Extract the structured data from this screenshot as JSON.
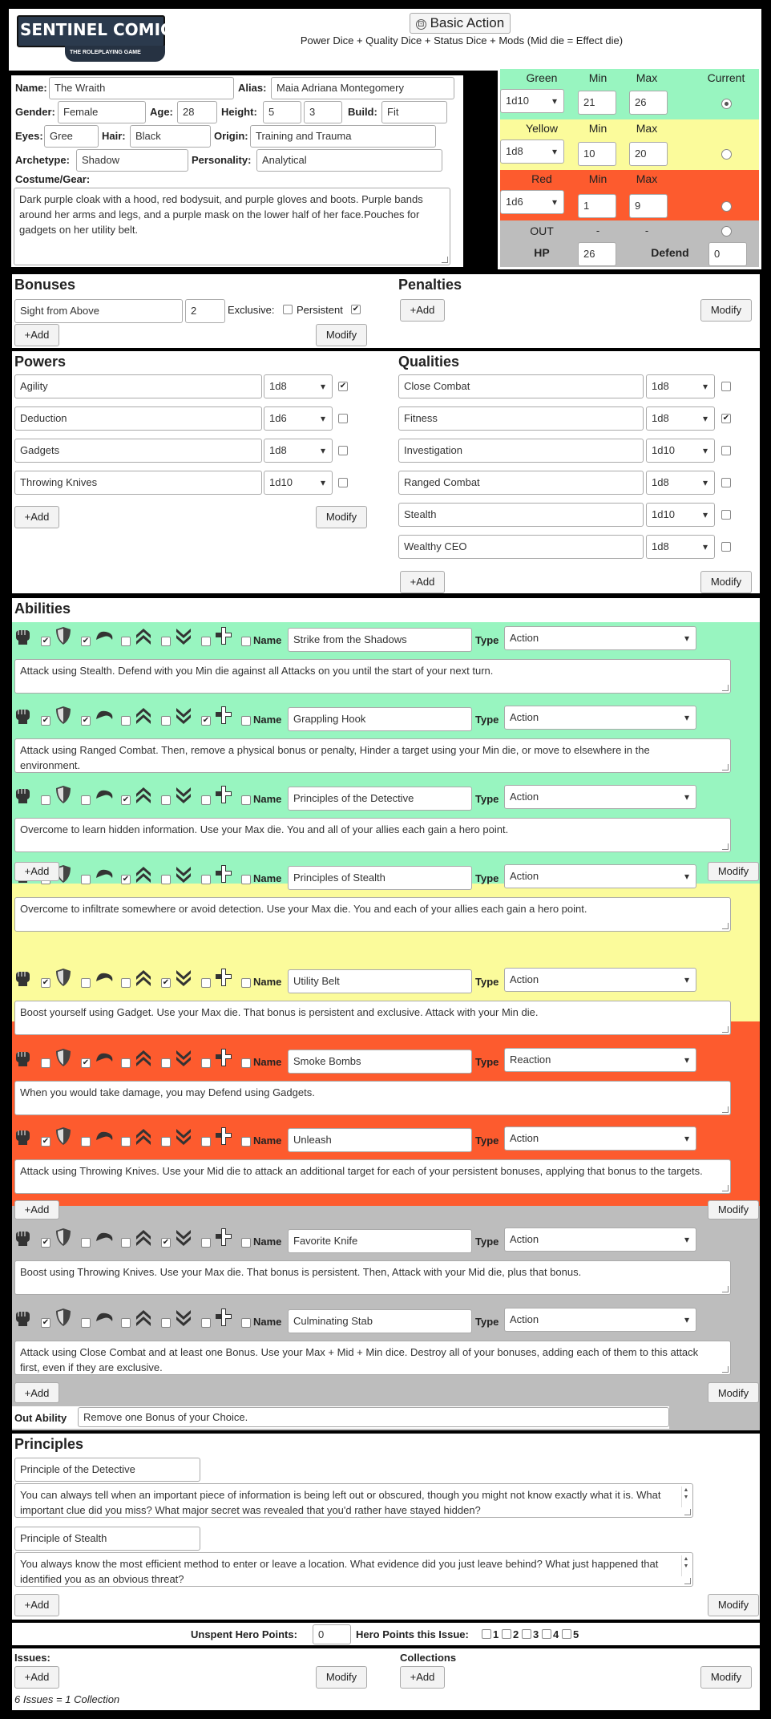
{
  "header": {
    "logo_main": "SENTINEL COMICS",
    "logo_sub": "THE ROLEPLAYING GAME",
    "basic_action": "Basic Action",
    "formula": "Power Dice + Quality Dice + Status Dice + Mods (Mid die = Effect die)"
  },
  "hero": {
    "name_label": "Name:",
    "name": "The Wraith",
    "alias_label": "Alias:",
    "alias": "Maia Adriana Montegomery",
    "gender_label": "Gender:",
    "gender": "Female",
    "age_label": "Age:",
    "age": "28",
    "height_label": "Height:",
    "height_ft": "5",
    "height_in": "3",
    "build_label": "Build:",
    "build": "Fit",
    "eyes_label": "Eyes:",
    "eyes": "Gree",
    "hair_label": "Hair:",
    "hair": "Black",
    "origin_label": "Origin:",
    "origin": "Training and Trauma",
    "archetype_label": "Archetype:",
    "archetype": "Shadow",
    "personality_label": "Personality:",
    "personality": "Analytical",
    "costume_label": "Costume/Gear:",
    "costume": "Dark purple cloak with a hood, red bodysuit, and purple gloves and boots. Purple bands around her arms and legs, and a purple mask on the lower half of her face.Pouches for gadgets on her utility belt."
  },
  "status": {
    "green_label": "Green",
    "yellow_label": "Yellow",
    "red_label": "Red",
    "min_label": "Min",
    "max_label": "Max",
    "current_label": "Current",
    "green_die": "1d10",
    "green_min": "21",
    "green_max": "26",
    "yellow_die": "1d8",
    "yellow_min": "10",
    "yellow_max": "20",
    "red_die": "1d6",
    "red_min": "1",
    "red_max": "9",
    "out_label": "OUT",
    "dash": "-",
    "hp_label": "HP",
    "hp": "26",
    "defend_label": "Defend",
    "defend": "0",
    "colors": {
      "green": "#98f5c0",
      "yellow": "#fbfb9b",
      "red": "#fd5b2e",
      "gray": "#bdbdbd"
    }
  },
  "bonuses": {
    "title": "Bonuses",
    "item_name": "Sight from Above",
    "item_value": "2",
    "exclusive_label": "Exclusive:",
    "persistent_label": "Persistent",
    "add": "+Add",
    "modify": "Modify"
  },
  "penalties": {
    "title": "Penalties",
    "add": "+Add",
    "modify": "Modify"
  },
  "powers": {
    "title": "Powers",
    "items": [
      {
        "name": "Agility",
        "die": "1d8",
        "checked": "✔"
      },
      {
        "name": "Deduction",
        "die": "1d6",
        "checked": ""
      },
      {
        "name": "Gadgets",
        "die": "1d8",
        "checked": ""
      },
      {
        "name": "Throwing Knives",
        "die": "1d10",
        "checked": ""
      }
    ],
    "add": "+Add",
    "modify": "Modify"
  },
  "qualities": {
    "title": "Qualities",
    "items": [
      {
        "name": "Close Combat",
        "die": "1d8",
        "checked": ""
      },
      {
        "name": "Fitness",
        "die": "1d8",
        "checked": "✔"
      },
      {
        "name": "Investigation",
        "die": "1d10",
        "checked": ""
      },
      {
        "name": "Ranged Combat",
        "die": "1d8",
        "checked": ""
      },
      {
        "name": "Stealth",
        "die": "1d10",
        "checked": ""
      },
      {
        "name": "Wealthy CEO",
        "die": "1d8",
        "checked": ""
      }
    ],
    "add": "+Add",
    "modify": "Modify"
  },
  "abilities": {
    "title": "Abilities",
    "name_label": "Name",
    "type_label": "Type",
    "add": "+Add",
    "modify": "Modify",
    "icons": [
      "fist-icon",
      "shield-icon",
      "swirl-icon",
      "chevrons-up-icon",
      "chevrons-down-icon",
      "plus-cross-icon"
    ],
    "items": [
      {
        "name": "Strike from the Shadows",
        "type": "Action",
        "checks": [
          "✔",
          "✔",
          "",
          "",
          "",
          ""
        ],
        "desc": "Attack using Stealth. Defend with you Min die against all Attacks on you until the start of your next turn."
      },
      {
        "name": "Grappling Hook",
        "type": "Action",
        "checks": [
          "✔",
          "✔",
          "",
          "",
          "✔",
          ""
        ],
        "desc": "Attack using Ranged Combat. Then, remove a physical bonus or penalty, Hinder a target using your Min die, or move to elsewhere in the environment."
      },
      {
        "name": "Principles of the Detective",
        "type": "Action",
        "checks": [
          "",
          "",
          "✔",
          "",
          "",
          ""
        ],
        "desc": "Overcome to learn hidden information. Use your Max die. You and all of your allies each gain a hero point."
      },
      {
        "name": "Principles of Stealth",
        "type": "Action",
        "checks": [
          "",
          "",
          "✔",
          "",
          "",
          ""
        ],
        "desc": "Overcome to infiltrate somewhere or avoid detection. Use your Max die. You and each of your allies each gain a hero point."
      },
      {
        "name": "Utility Belt",
        "type": "Action",
        "checks": [
          "✔",
          "",
          "",
          "✔",
          "",
          ""
        ],
        "desc": "Boost yourself using Gadget. Use your Max die. That bonus is persistent and exclusive. Attack with your Min die."
      },
      {
        "name": "Smoke Bombs",
        "type": "Reaction",
        "checks": [
          "",
          "✔",
          "",
          "",
          "",
          ""
        ],
        "desc": "When you would take damage, you may Defend using Gadgets."
      },
      {
        "name": "Unleash",
        "type": "Action",
        "checks": [
          "✔",
          "",
          "",
          "",
          "",
          ""
        ],
        "desc": "Attack using Throwing Knives. Use your Mid die to attack an additional target for each of your persistent bonuses, applying that bonus to the targets."
      },
      {
        "name": "Favorite Knife",
        "type": "Action",
        "checks": [
          "✔",
          "",
          "",
          "✔",
          "",
          ""
        ],
        "desc": "Boost using Throwing Knives. Use your Max die. That bonus is persistent. Then, Attack with your Mid die, plus that bonus."
      },
      {
        "name": "Culminating Stab",
        "type": "Action",
        "checks": [
          "✔",
          "",
          "",
          "",
          "",
          ""
        ],
        "desc": "Attack using Close Combat and at least one Bonus. Use your Max + Mid + Min dice. Destroy all of your bonuses, adding each of them to this attack first, even if they are exclusive."
      }
    ],
    "out_label": "Out Ability",
    "out_value": "Remove one Bonus of your Choice."
  },
  "principles": {
    "title": "Principles",
    "items": [
      {
        "name": "Principle of the Detective",
        "desc": "You can always tell when an important piece of information is being left out or obscured, though you might not know exactly what it is. What important clue did you miss? What major secret was revealed that you'd rather have stayed hidden?"
      },
      {
        "name": "Principle of Stealth",
        "desc": "You always know the most efficient method to enter or leave a location. What evidence did you just leave behind? What just happened that identified you as an obvious threat?"
      }
    ],
    "add": "+Add",
    "modify": "Modify"
  },
  "hero_points": {
    "unspent_label": "Unspent Hero Points:",
    "unspent": "0",
    "issue_label": "Hero Points this Issue:",
    "boxes": [
      "1",
      "2",
      "3",
      "4",
      "5"
    ]
  },
  "issues": {
    "title": "Issues:",
    "add": "+Add",
    "modify": "Modify",
    "note": "6 Issues = 1 Collection"
  },
  "collections": {
    "title": "Collections",
    "add": "+Add",
    "modify": "Modify"
  }
}
